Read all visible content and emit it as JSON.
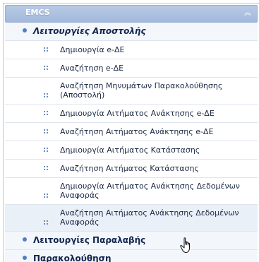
{
  "header": {
    "title": "EMCS",
    "collapse_icon": "double-chevron-up-icon"
  },
  "groups": {
    "send": {
      "label": "Λειτουργίες Αποστολής"
    },
    "receive": {
      "label": "Λειτουργίες Παραλαβής"
    },
    "monitor": {
      "label": "Παρακολούθηση"
    }
  },
  "items": [
    {
      "label": "Δημιουργία e-ΔΕ"
    },
    {
      "label": "Αναζήτηση e-ΔΕ"
    },
    {
      "label": "Αναζήτηση Μηνυμάτων Παρακολούθησης (Αποστολή)"
    },
    {
      "label": "Δημιουργία Αιτήματος Ανάκτησης e-ΔΕ"
    },
    {
      "label": "Αναζήτηση Αιτήματος Ανάκτησης e-ΔΕ"
    },
    {
      "label": "Δημιουργία Αιτήματος Κατάστασης"
    },
    {
      "label": "Αναζήτηση Αιτήματος Κατάστασης"
    },
    {
      "label": "Δημιουργία Αιτήματος Ανάκτησης Δεδομένων Αναφοράς"
    },
    {
      "label": "Αναζήτηση Αιτήματος Ανάκτησης Δεδομένων Αναφοράς"
    }
  ],
  "colors": {
    "header": "#a3b9dc",
    "bullet": "#4d7fc4",
    "hover": "#eaf0f8"
  }
}
